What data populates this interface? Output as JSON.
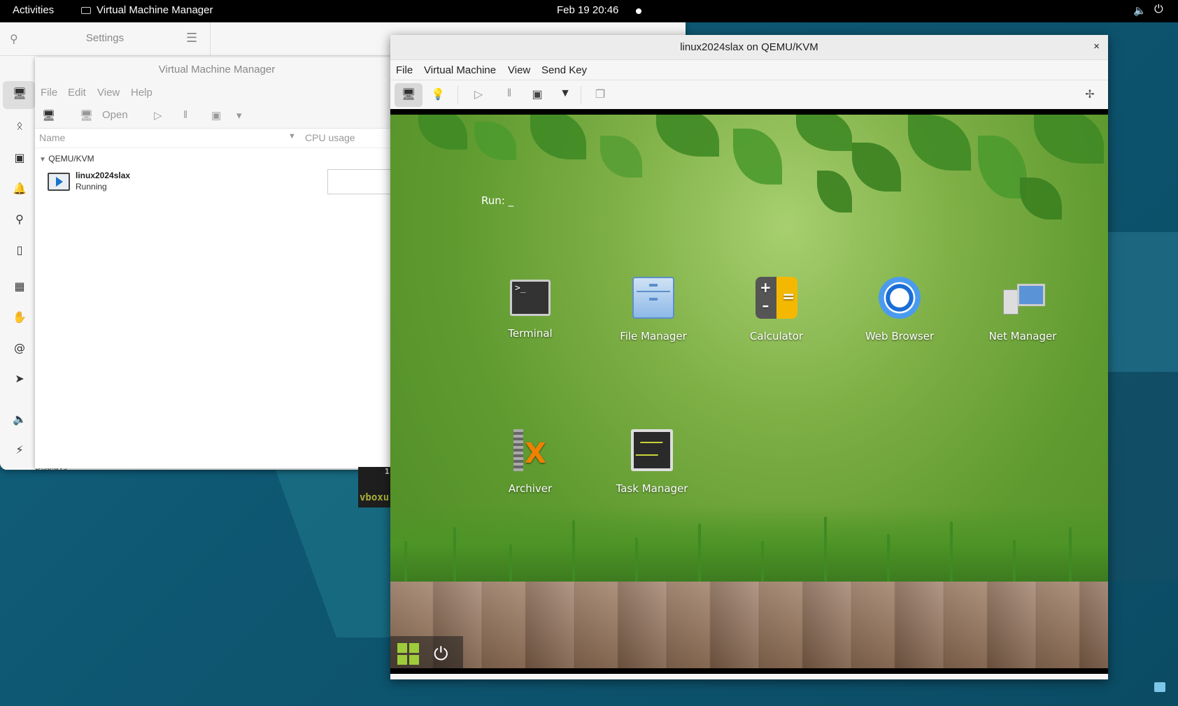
{
  "topbar": {
    "activities": "Activities",
    "app_name": "Virtual Machine Manager",
    "clock": "Feb 19  20:46"
  },
  "settings": {
    "title": "Settings",
    "bottom_text": "Displays"
  },
  "vmm": {
    "title": "Virtual Machine Manager",
    "menu": [
      "File",
      "Edit",
      "View",
      "Help"
    ],
    "toolbar_open": "Open",
    "columns": {
      "name": "Name",
      "cpu": "CPU usage"
    },
    "group": "QEMU/KVM",
    "vm": {
      "name": "linux2024slax",
      "state": "Running"
    }
  },
  "terminal_sliver": {
    "number": "1",
    "text": "vboxu"
  },
  "console": {
    "title": "linux2024slax on QEMU/KVM",
    "close": "×",
    "menu": [
      "File",
      "Virtual Machine",
      "View",
      "Send Key"
    ],
    "guest": {
      "run_label": "Run:  _",
      "icons": [
        {
          "label": "Terminal",
          "icon": "terminal-icon"
        },
        {
          "label": "File Manager",
          "icon": "file-manager-icon"
        },
        {
          "label": "Calculator",
          "icon": "calculator-icon"
        },
        {
          "label": "Web Browser",
          "icon": "web-browser-icon"
        },
        {
          "label": "Net Manager",
          "icon": "net-manager-icon"
        },
        {
          "label": "Archiver",
          "icon": "archiver-icon"
        },
        {
          "label": "Task Manager",
          "icon": "task-manager-icon"
        }
      ]
    }
  },
  "colors": {
    "desktop": "#0f5a74",
    "guest_green": "#5e9a2f",
    "start_green": "#9ecb3b"
  }
}
